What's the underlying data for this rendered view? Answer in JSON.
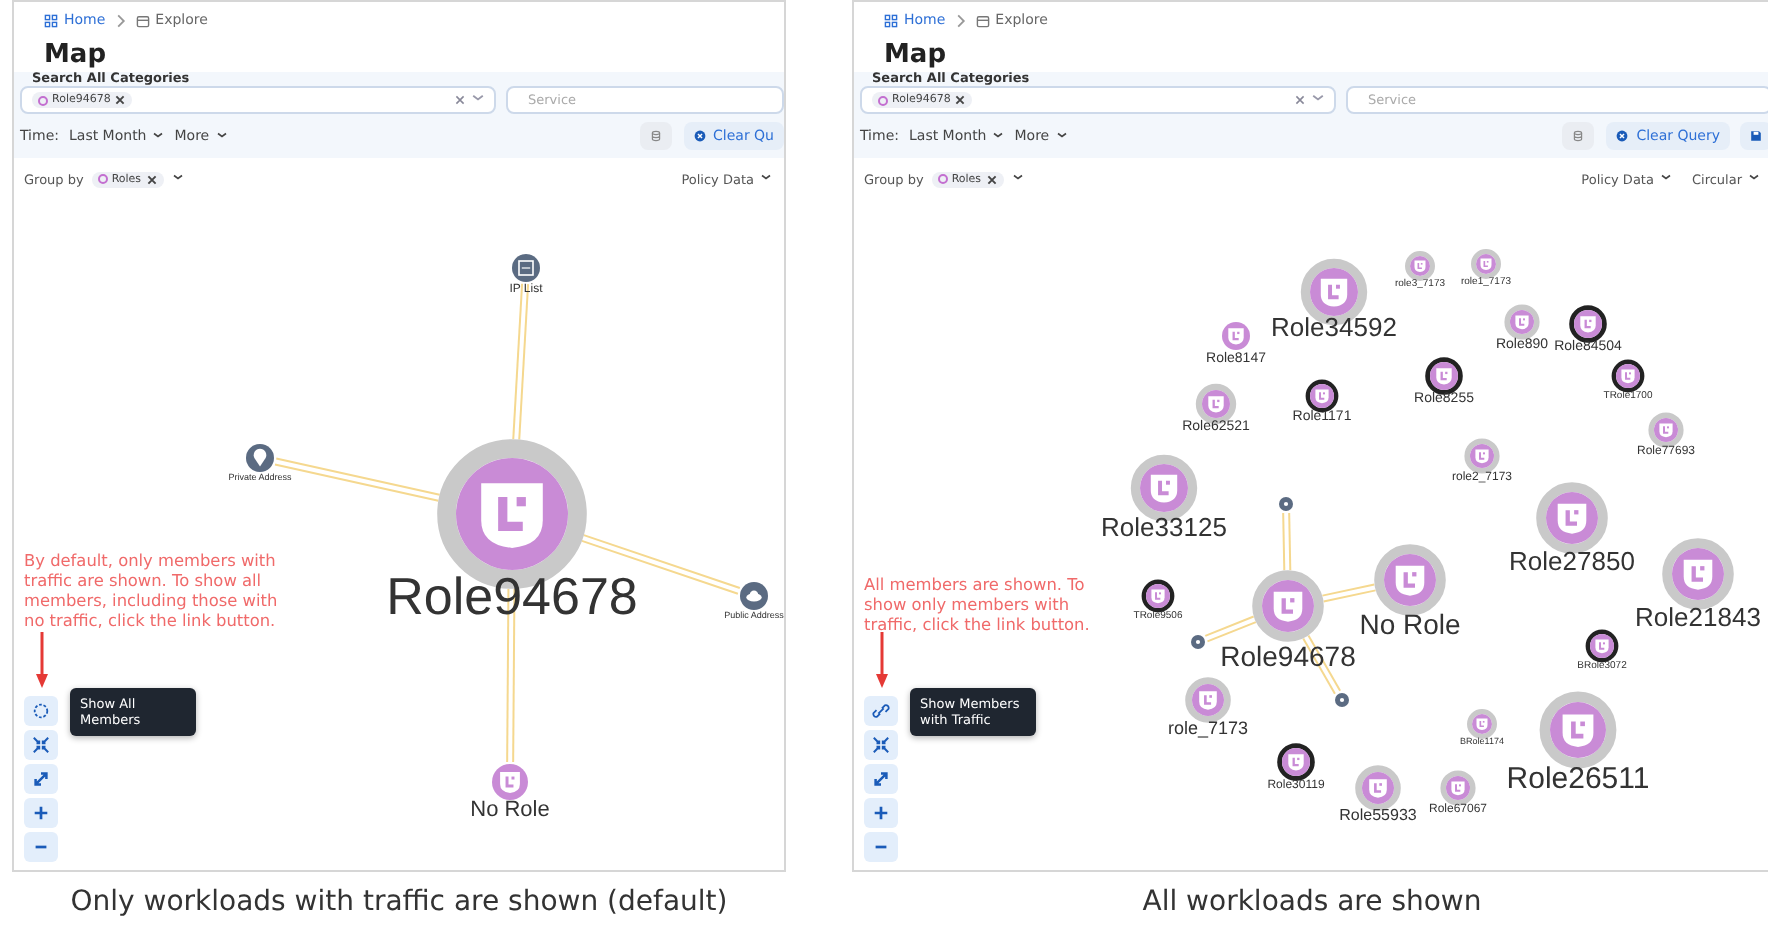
{
  "panels": [
    {
      "breadcrumb": [
        {
          "label": "Home",
          "kind": "link"
        },
        {
          "label": "Explore",
          "kind": "page"
        }
      ],
      "title": "Map",
      "search": {
        "label": "Search All Categories",
        "chips": [
          "Role94678"
        ],
        "placeholder": "Service"
      },
      "time": {
        "label": "Time:",
        "value": "Last Month",
        "more": "More"
      },
      "actions": [
        {
          "kind": "database"
        },
        {
          "kind": "clear",
          "label": "Clear Qu"
        }
      ],
      "group_by": {
        "label": "Group by",
        "chip": "Roles"
      },
      "view_options": [
        "Policy Data"
      ],
      "map": {
        "focus_node": {
          "kind": "role",
          "label": "Role94678",
          "ring": true,
          "outlined": false
        },
        "nodes": [
          {
            "kind": "list",
            "label": "IP List",
            "ring": false,
            "outlined": false,
            "traffic": true
          },
          {
            "kind": "location",
            "label": "Private Address",
            "ring": false,
            "outlined": false,
            "traffic": true
          },
          {
            "kind": "cloud",
            "label": "Public Address",
            "ring": false,
            "outlined": false,
            "traffic": true
          },
          {
            "kind": "role",
            "label": "No Role",
            "ring": false,
            "outlined": false,
            "traffic": true
          }
        ]
      },
      "annotation": "By default, only members with traffic are shown. To show all members, including those with no traffic, click the link button.",
      "controls": [
        {
          "kind": "show-all"
        },
        {
          "kind": "fit"
        },
        {
          "kind": "expand"
        },
        {
          "kind": "zoom-in"
        },
        {
          "kind": "zoom-out"
        }
      ],
      "tooltip": "Show All Members",
      "caption": "Only workloads with traffic are shown (default)"
    },
    {
      "breadcrumb": [
        {
          "label": "Home",
          "kind": "link"
        },
        {
          "label": "Explore",
          "kind": "page"
        }
      ],
      "title": "Map",
      "search": {
        "label": "Search All Categories",
        "chips": [
          "Role94678"
        ],
        "placeholder": "Service"
      },
      "time": {
        "label": "Time:",
        "value": "Last Month",
        "more": "More"
      },
      "actions": [
        {
          "kind": "database"
        },
        {
          "kind": "clear",
          "label": "Clear Query"
        },
        {
          "kind": "save"
        }
      ],
      "group_by": {
        "label": "Group by",
        "chip": "Roles"
      },
      "view_options": [
        "Policy Data",
        "Circular"
      ],
      "map": {
        "focus_node": {
          "kind": "role",
          "label": "Role94678",
          "ring": true,
          "outlined": false
        },
        "nodes": [
          {
            "kind": "role",
            "label": "role3_7173",
            "ring": true,
            "outlined": false,
            "traffic": false
          },
          {
            "kind": "role",
            "label": "role1_7173",
            "ring": true,
            "outlined": false,
            "traffic": false
          },
          {
            "kind": "role",
            "label": "Role34592",
            "ring": true,
            "outlined": false,
            "traffic": false
          },
          {
            "kind": "role",
            "label": "Role8147",
            "ring": false,
            "outlined": false,
            "traffic": false
          },
          {
            "kind": "role",
            "label": "Role890",
            "ring": true,
            "outlined": false,
            "traffic": false
          },
          {
            "kind": "role",
            "label": "Role84504",
            "ring": false,
            "outlined": true,
            "traffic": false
          },
          {
            "kind": "role",
            "label": "Role8255",
            "ring": false,
            "outlined": true,
            "traffic": false
          },
          {
            "kind": "role",
            "label": "TRole1700",
            "ring": false,
            "outlined": true,
            "traffic": false
          },
          {
            "kind": "role",
            "label": "Role62521",
            "ring": true,
            "outlined": false,
            "traffic": false
          },
          {
            "kind": "role",
            "label": "Role1171",
            "ring": false,
            "outlined": true,
            "traffic": false
          },
          {
            "kind": "role",
            "label": "Role77693",
            "ring": true,
            "outlined": false,
            "traffic": false
          },
          {
            "kind": "role",
            "label": "role2_7173",
            "ring": true,
            "outlined": false,
            "traffic": false
          },
          {
            "kind": "role",
            "label": "Role33125",
            "ring": true,
            "outlined": false,
            "traffic": false
          },
          {
            "kind": "endpoint",
            "ring": false,
            "outlined": false,
            "traffic": true
          },
          {
            "kind": "role",
            "label": "Role27850",
            "ring": true,
            "outlined": false,
            "traffic": false
          },
          {
            "kind": "role",
            "label": "TRole9506",
            "ring": false,
            "outlined": true,
            "traffic": false
          },
          {
            "kind": "role",
            "label": "No Role",
            "ring": true,
            "outlined": false,
            "traffic": true
          },
          {
            "kind": "role",
            "label": "Role21843",
            "ring": true,
            "outlined": false,
            "traffic": false
          },
          {
            "kind": "endpoint",
            "ring": false,
            "outlined": false,
            "traffic": true
          },
          {
            "kind": "role",
            "label": "BRole3072",
            "ring": false,
            "outlined": true,
            "traffic": false
          },
          {
            "kind": "role",
            "label": "role_7173",
            "ring": true,
            "outlined": false,
            "traffic": false
          },
          {
            "kind": "endpoint",
            "ring": false,
            "outlined": false,
            "traffic": true
          },
          {
            "kind": "role",
            "label": "BRole1174",
            "ring": true,
            "outlined": false,
            "traffic": false
          },
          {
            "kind": "role",
            "label": "Role26511",
            "ring": true,
            "outlined": false,
            "traffic": false
          },
          {
            "kind": "role",
            "label": "Role30119",
            "ring": false,
            "outlined": true,
            "traffic": false
          },
          {
            "kind": "role",
            "label": "Role55933",
            "ring": true,
            "outlined": false,
            "traffic": false
          },
          {
            "kind": "role",
            "label": "Role67067",
            "ring": true,
            "outlined": false,
            "traffic": false
          }
        ]
      },
      "annotation": "All members are shown. To show only members with traffic, click the link button.",
      "controls": [
        {
          "kind": "link"
        },
        {
          "kind": "fit"
        },
        {
          "kind": "expand"
        },
        {
          "kind": "zoom-in"
        },
        {
          "kind": "zoom-out"
        }
      ],
      "tooltip": "Show Members with Traffic",
      "caption": "All workloads are shown"
    }
  ]
}
